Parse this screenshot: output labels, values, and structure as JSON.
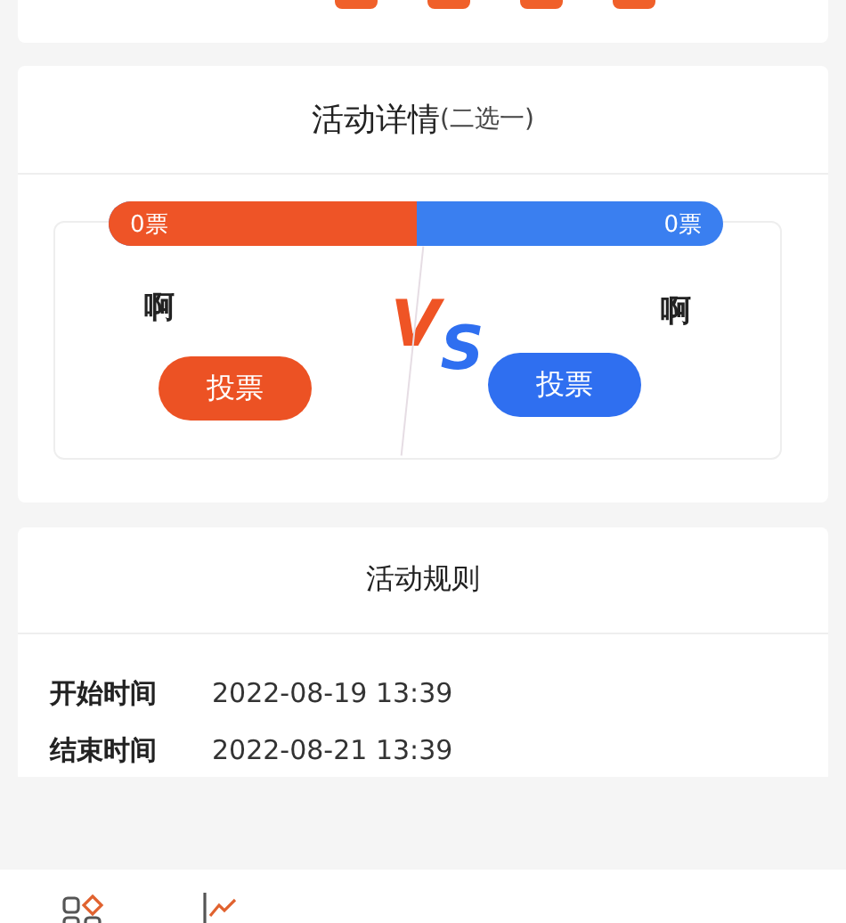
{
  "vote": {
    "title": "活动详情",
    "subtitle": "(二选一)",
    "level": 0.5,
    "options": [
      {
        "votes": "0票",
        "name": "啊",
        "button": "投票"
      },
      {
        "votes": "0票",
        "name": "啊",
        "button": "投票"
      }
    ],
    "vs_left": "V",
    "vs_right": "S"
  },
  "rules": {
    "title": "活动规则",
    "rows": [
      {
        "label": "开始时间",
        "value": "2022-08-19 13:39"
      },
      {
        "label": "结束时间",
        "value": "2022-08-21 13:39"
      }
    ]
  }
}
